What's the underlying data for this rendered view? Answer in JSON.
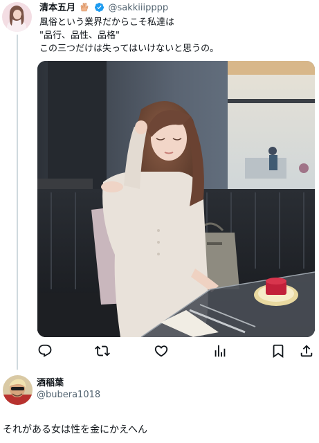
{
  "tweet": {
    "author_name": "清本五月",
    "author_handle": "@sakkiiipppp",
    "verified": true,
    "name_emoji": "hands-icon",
    "text_lines": [
      "風俗という業界だからこそ私達は",
      "\"品行、品性、品格\"",
      "この三つだけは失ってはいけないと思うの。"
    ],
    "photo": "woman-in-white-knit-at-restaurant-booth",
    "actions": [
      "reply-icon",
      "retweet-icon",
      "like-icon",
      "views-icon",
      "bookmark-icon",
      "share-icon"
    ]
  },
  "reply": {
    "author_name": "酒稲葉",
    "author_handle": "@bubera1018",
    "text": "それがある女は性を金にかえへん"
  },
  "colors": {
    "text": "#0f1419",
    "secondary": "#536471",
    "verified": "#1d9bf0",
    "thread_line": "#cfd9de"
  }
}
